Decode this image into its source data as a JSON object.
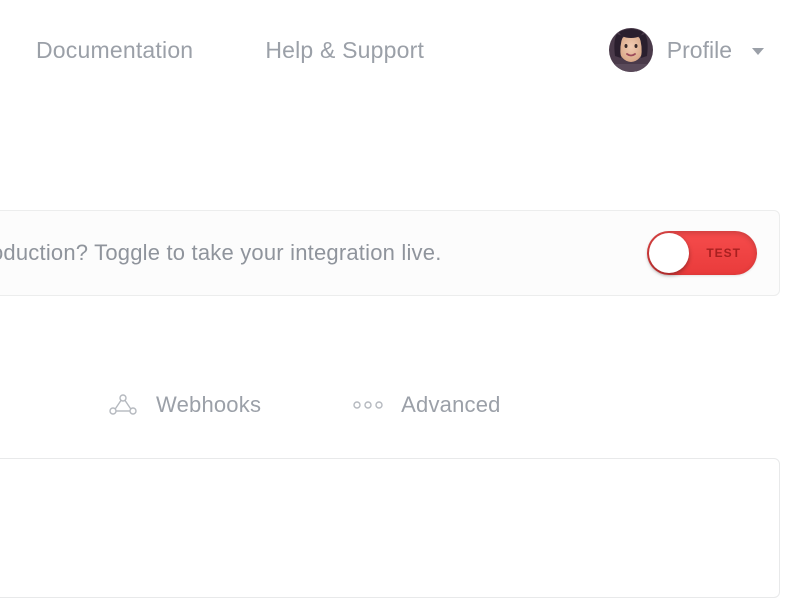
{
  "nav": {
    "documentation": "Documentation",
    "help_support": "Help & Support",
    "profile": "Profile"
  },
  "banner": {
    "text": "oduction? Toggle to take your integration live.",
    "toggle_label": "TEST",
    "toggle_state": "test"
  },
  "tabs": {
    "webhooks": "Webhooks",
    "advanced": "Advanced"
  },
  "colors": {
    "text_muted": "#9ba0a8",
    "toggle_red": "#e93b3b",
    "border_light": "#eceded"
  }
}
